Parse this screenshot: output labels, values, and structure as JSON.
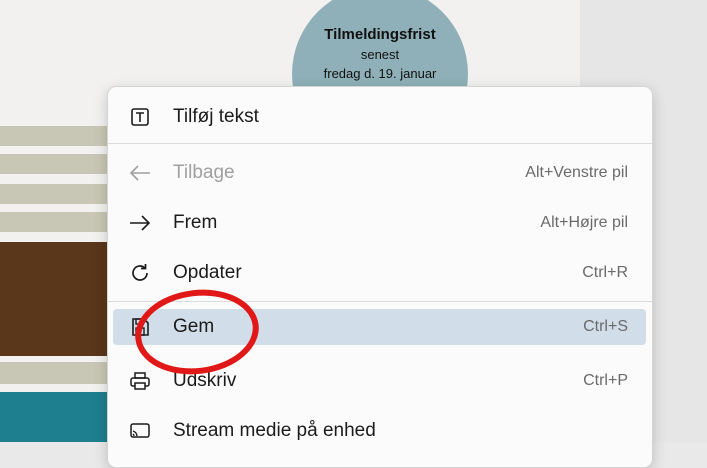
{
  "background": {
    "badge": {
      "title": "Tilmeldingsfrist",
      "line2": "senest",
      "line3": "fredag d. 19. januar"
    }
  },
  "menu": {
    "items": [
      {
        "label": "Tilføj tekst",
        "shortcut": "",
        "icon": "text-box-icon",
        "disabled": false
      },
      {
        "label": "Tilbage",
        "shortcut": "Alt+Venstre pil",
        "icon": "arrow-left-icon",
        "disabled": true
      },
      {
        "label": "Frem",
        "shortcut": "Alt+Højre pil",
        "icon": "arrow-right-icon",
        "disabled": false
      },
      {
        "label": "Opdater",
        "shortcut": "Ctrl+R",
        "icon": "refresh-icon",
        "disabled": false
      },
      {
        "label": "Gem",
        "shortcut": "Ctrl+S",
        "icon": "save-icon",
        "highlighted": true
      },
      {
        "label": "Udskriv",
        "shortcut": "Ctrl+P",
        "icon": "print-icon",
        "disabled": false
      },
      {
        "label": "Stream medie på enhed",
        "shortcut": "",
        "icon": "cast-icon",
        "disabled": false
      }
    ]
  },
  "annotation": {
    "color": "#e01818",
    "target": "Gem"
  }
}
